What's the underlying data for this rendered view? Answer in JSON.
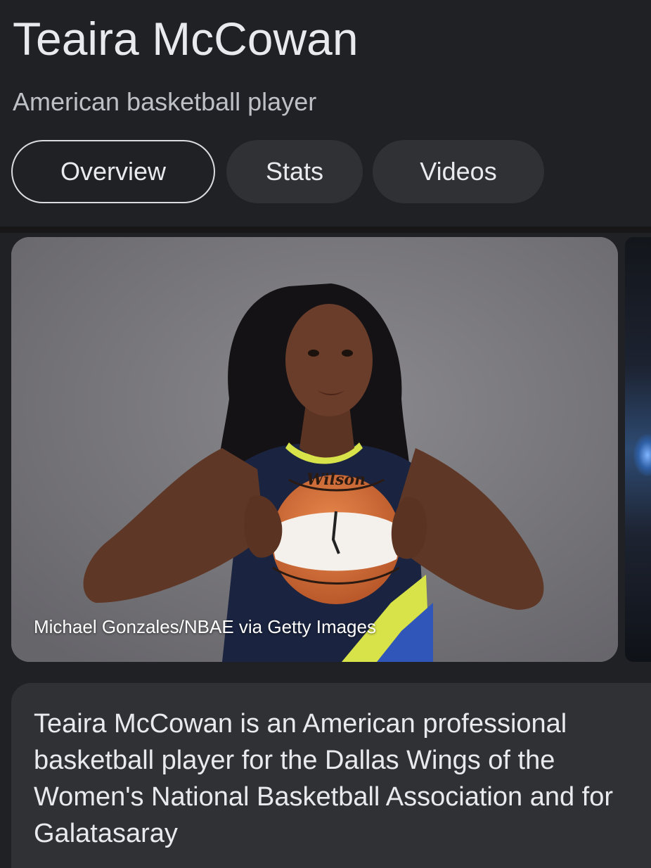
{
  "header": {
    "title": "Teaira McCowan",
    "subtitle": "American basketball player"
  },
  "tabs": [
    {
      "label": "Overview",
      "active": true
    },
    {
      "label": "Stats",
      "active": false
    },
    {
      "label": "Videos",
      "active": false
    }
  ],
  "image": {
    "credit": "Michael Gonzales/NBAE via Getty Images",
    "ball_brand": "Wilson"
  },
  "description": {
    "text": "Teaira McCowan is an American professional basketball player for the Dallas Wings of the Women's National Basketball Association and for Galatasaray"
  },
  "colors": {
    "background": "#202124",
    "chip_background": "#303134",
    "text_primary": "#e8eaed",
    "text_secondary": "#bdc1c6",
    "active_chip_border": "#dadce0"
  }
}
